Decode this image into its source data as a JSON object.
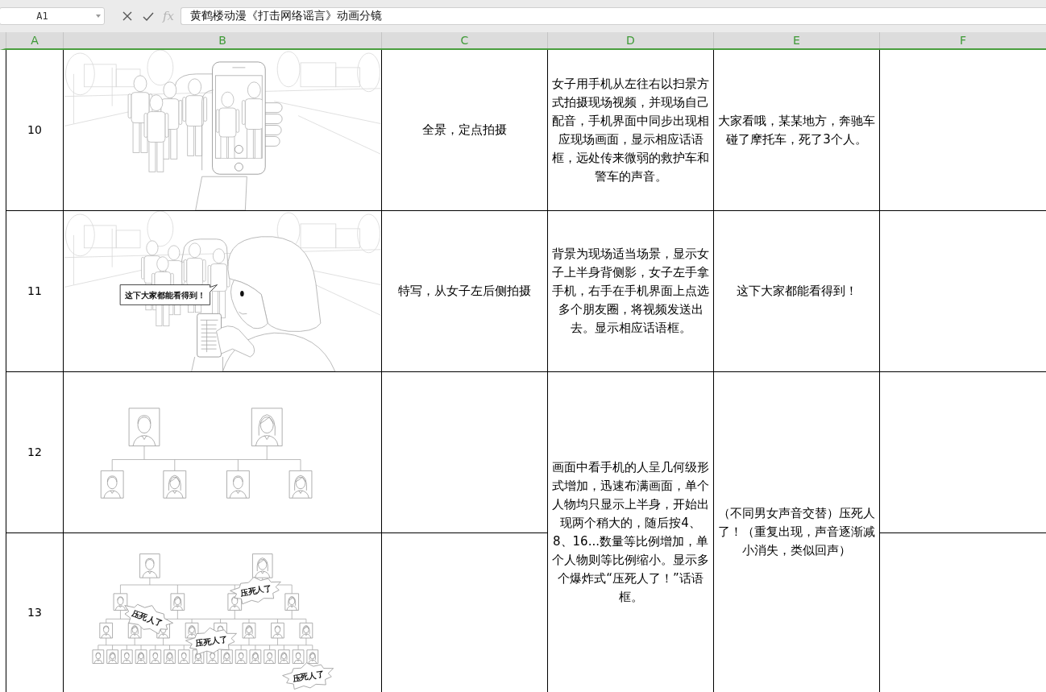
{
  "name_box": {
    "value": "A1"
  },
  "formula_bar": {
    "function_label": "fx",
    "value": "黄鹤楼动漫《打击网络谣言》动画分镜"
  },
  "column_headers": [
    "A",
    "B",
    "C",
    "D",
    "E",
    "F"
  ],
  "rows": [
    {
      "cell_a": "10",
      "cell_b": {
        "kind": "phone_filming"
      },
      "cell_c": "全景，定点拍摄",
      "cell_d": "女子用手机从左往右以扫景方式拍摄现场视频，并现场自己配音，手机界面中同步出现相应现场画面，显示相应话语框，远处传来微弱的救护车和警车的声音。",
      "cell_e": "大家看哦，某某地方，奔驰车碰了摩托车，死了3个人。"
    },
    {
      "cell_a": "11",
      "cell_b": {
        "kind": "woman_sharing",
        "bubble": "这下大家都能看得到！"
      },
      "cell_c": "特写，从女子左后侧拍摄",
      "cell_d": "背景为现场适当场景，显示女子上半身背侧影，女子左手拿手机，右手在手机界面上点选多个朋友圈，将视频发送出去。显示相应话语框。",
      "cell_e": "这下大家都能看得到！"
    },
    {
      "cell_a": "12",
      "cell_b": {
        "kind": "tree_small"
      },
      "cell_d": {
        "text": "画面中看手机的人呈几何级形式增加，迅速布满画面，单个人物均只显示上半身，开始出现两个稍大的，随后按4、8、16...数量等比例增加，单个人物则等比例缩小。显示多个爆炸式“压死人了！”话语框。",
        "merged_down": true
      },
      "cell_e": {
        "text": "（不同男女声音交替）压死人了！（重复出现，声音逐渐减小消失，类似回声）",
        "merged_down": true
      }
    },
    {
      "cell_a": "13",
      "cell_b": {
        "kind": "tree_large",
        "bursts": [
          "压死人了",
          "压死人了",
          "压死人了",
          "压死人了"
        ]
      }
    }
  ]
}
